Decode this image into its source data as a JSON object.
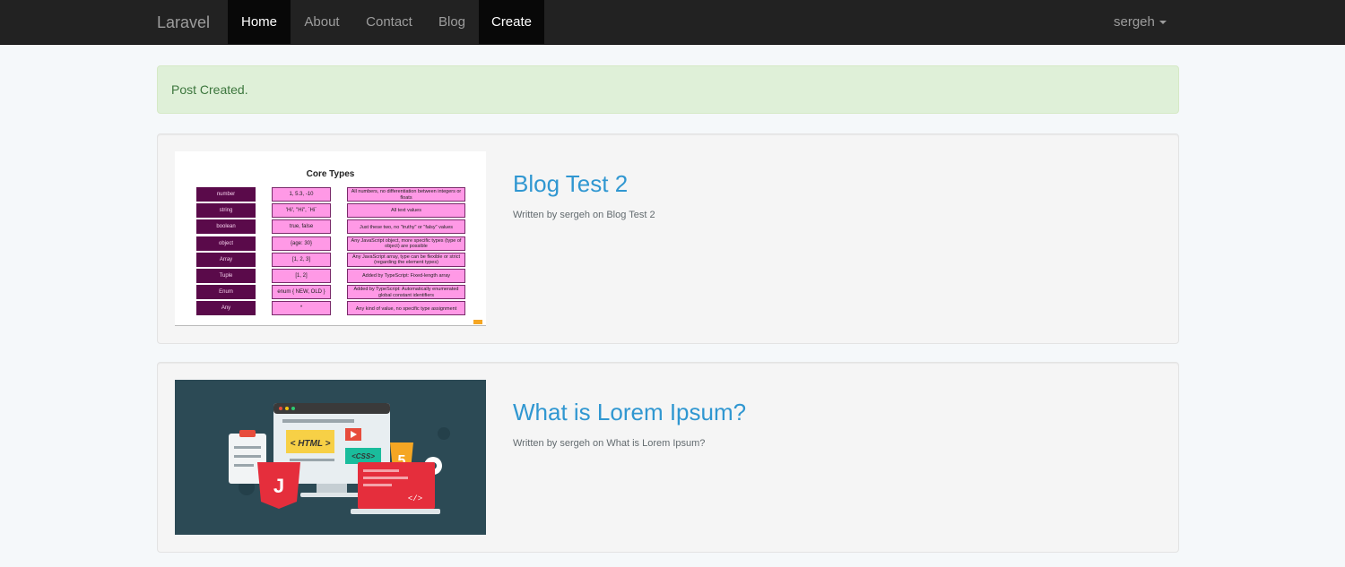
{
  "navbar": {
    "brand": "Laravel",
    "items": [
      "Home",
      "About",
      "Contact",
      "Blog",
      "Create"
    ],
    "user": "sergeh"
  },
  "alert": {
    "message": "Post Created."
  },
  "posts": [
    {
      "title": "Blog Test 2",
      "meta": "Written by sergeh on Blog Test 2",
      "thumbnail": {
        "title": "Core Types",
        "rows": [
          [
            "number",
            "1, 5.3, -10",
            "All numbers, no differentiation between integers or floats"
          ],
          [
            "string",
            "'Hi', \"Hi\", `Hi`",
            "All text values"
          ],
          [
            "boolean",
            "true, false",
            "Just these two, no \"truthy\" or \"falsy\" values"
          ],
          [
            "object",
            "{age: 30}",
            "Any JavaScript object, more specific types (type of object) are possible"
          ],
          [
            "Array",
            "[1, 2, 3]",
            "Any JavaScript array, type can be flexible or strict (regarding the element types)"
          ],
          [
            "Tuple",
            "[1, 2]",
            "Added by TypeScript: Fixed-length array"
          ],
          [
            "Enum",
            "enum { NEW, OLD }",
            "Added by TypeScript: Automatically enumerated global constant identifiers"
          ],
          [
            "Any",
            "*",
            "Any kind of value, no specific type assignment"
          ]
        ]
      }
    },
    {
      "title": "What is Lorem Ipsum?",
      "meta": "Written by sergeh on What is Lorem Ipsum?",
      "thumbnail": {
        "html_label": "< HTML >",
        "css_label": "<CSS>",
        "html5_badge": "5",
        "code_label": "</>"
      }
    }
  ],
  "colors": {
    "navbar_bg": "#222222",
    "active_bg": "#080808",
    "link": "#3097d1",
    "alert_bg": "#dff0d8",
    "alert_text": "#3c763d"
  }
}
